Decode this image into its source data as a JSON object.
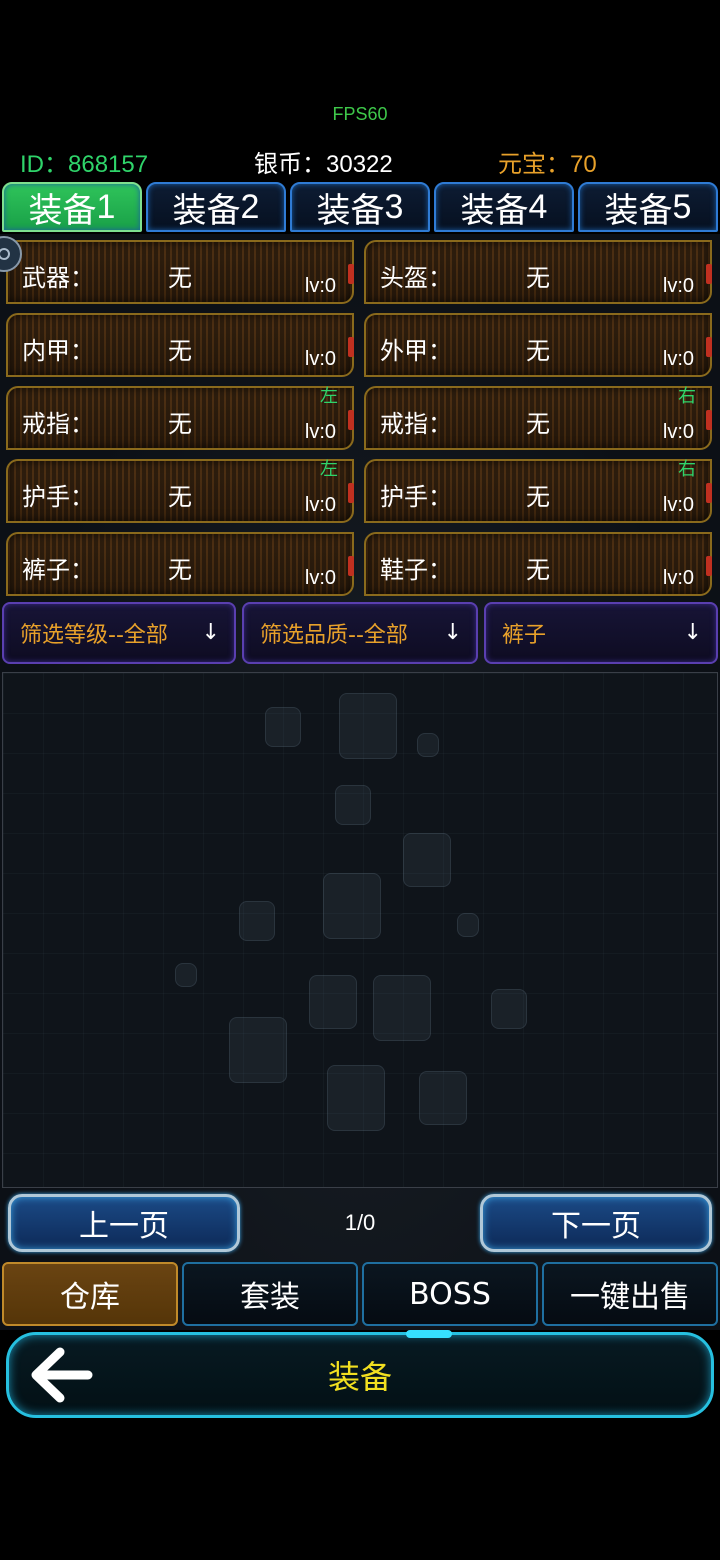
{
  "fps": "FPS60",
  "stats": {
    "id": "ID：868157",
    "silver": "银币：30322",
    "gold": "元宝：70"
  },
  "tabs": [
    {
      "label": "装备",
      "num": "1",
      "active": true
    },
    {
      "label": "装备",
      "num": "2",
      "active": false
    },
    {
      "label": "装备",
      "num": "3",
      "active": false
    },
    {
      "label": "装备",
      "num": "4",
      "active": false
    },
    {
      "label": "装备",
      "num": "5",
      "active": false
    }
  ],
  "slots": [
    {
      "label": "武器：",
      "value": "无",
      "level": "lv:0",
      "side": ""
    },
    {
      "label": "头盔：",
      "value": "无",
      "level": "lv:0",
      "side": ""
    },
    {
      "label": "内甲：",
      "value": "无",
      "level": "lv:0",
      "side": ""
    },
    {
      "label": "外甲：",
      "value": "无",
      "level": "lv:0",
      "side": ""
    },
    {
      "label": "戒指：",
      "value": "无",
      "level": "lv:0",
      "side": "左"
    },
    {
      "label": "戒指：",
      "value": "无",
      "level": "lv:0",
      "side": "右"
    },
    {
      "label": "护手：",
      "value": "无",
      "level": "lv:0",
      "side": "左"
    },
    {
      "label": "护手：",
      "value": "无",
      "level": "lv:0",
      "side": "右"
    },
    {
      "label": "裤子：",
      "value": "无",
      "level": "lv:0",
      "side": ""
    },
    {
      "label": "鞋子：",
      "value": "无",
      "level": "lv:0",
      "side": ""
    }
  ],
  "filters": {
    "level": "筛选等级--全部",
    "quality": "筛选品质--全部",
    "type": "裤子",
    "arrow": "↓"
  },
  "pager": {
    "prev": "上一页",
    "next": "下一页",
    "info": "1/0"
  },
  "bottom_tabs": [
    {
      "label": "仓库",
      "active": true
    },
    {
      "label": "套装",
      "active": false
    },
    {
      "label": "BOSS",
      "active": false
    },
    {
      "label": "一键出售",
      "active": false
    }
  ],
  "nav": {
    "title": "装备",
    "back_icon": "arrow-left-icon"
  },
  "colors": {
    "green": "#2fd46a",
    "gold": "#e8a12a",
    "title_yellow": "#f2e020",
    "cyan": "#26c0e0"
  }
}
